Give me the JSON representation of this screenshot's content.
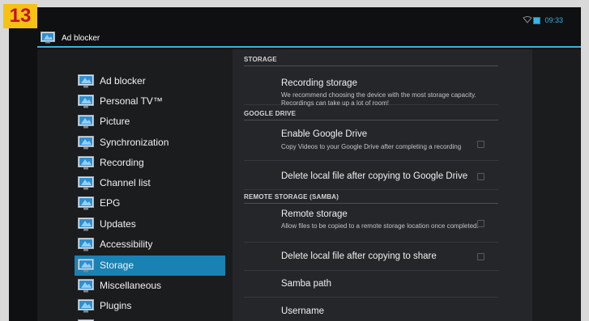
{
  "step_badge": "13",
  "status_bar": {
    "time": "09:33"
  },
  "action_bar": {
    "title": "Ad blocker"
  },
  "categories": [
    {
      "label": "Ad blocker",
      "selected": false
    },
    {
      "label": "Personal TV™",
      "selected": false
    },
    {
      "label": "Picture",
      "selected": false
    },
    {
      "label": "Synchronization",
      "selected": false
    },
    {
      "label": "Recording",
      "selected": false
    },
    {
      "label": "Channel list",
      "selected": false
    },
    {
      "label": "EPG",
      "selected": false
    },
    {
      "label": "Updates",
      "selected": false
    },
    {
      "label": "Accessibility",
      "selected": false
    },
    {
      "label": "Storage",
      "selected": true
    },
    {
      "label": "Miscellaneous",
      "selected": false
    },
    {
      "label": "Plugins",
      "selected": false
    }
  ],
  "sections": {
    "storage": "STORAGE",
    "google_drive": "GOOGLE DRIVE",
    "remote_storage": "REMOTE STORAGE (SAMBA)"
  },
  "prefs": {
    "recording_storage": {
      "title": "Recording storage",
      "summary": "We recommend choosing the device with the most storage capacity. Recordings can take up a lot of room!"
    },
    "enable_google_drive": {
      "title": "Enable Google Drive",
      "summary": "Copy Videos to your Google Drive after completing a recording",
      "checked": false
    },
    "delete_after_drive": {
      "title": "Delete local file after copying to Google Drive",
      "checked": false
    },
    "remote_storage": {
      "title": "Remote storage",
      "summary": "Allow files to be copied to a remote storage location once completed.",
      "checked": false
    },
    "delete_after_share": {
      "title": "Delete local file after copying to share",
      "checked": false
    },
    "samba_path": {
      "title": "Samba path"
    },
    "username": {
      "title": "Username"
    }
  },
  "colors": {
    "accent": "#33b5e5",
    "selected_row": "#1a81b3",
    "badge_bg": "#f5c211",
    "badge_text": "#c8102e"
  },
  "icons": {
    "category": "tv-monitor-icon",
    "app": "tv-monitor-icon",
    "wifi": "wifi-icon",
    "battery": "battery-icon"
  }
}
